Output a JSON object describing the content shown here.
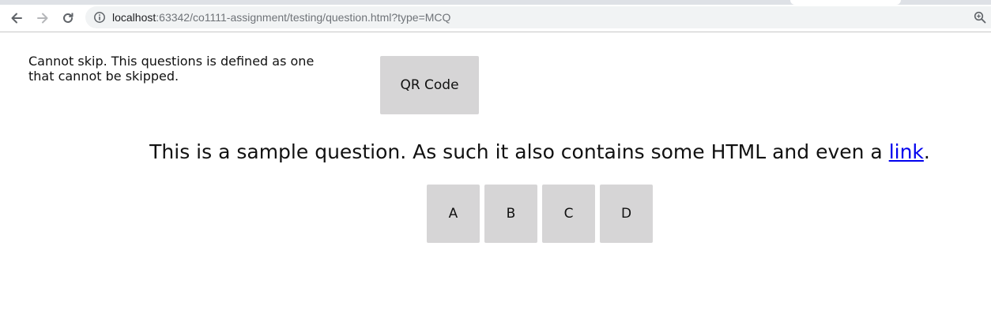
{
  "browser": {
    "url_host": "localhost",
    "url_path": ":63342/co1111-assignment/testing/question.html?type=MCQ",
    "icons": [
      "back-arrow-icon",
      "forward-arrow-icon",
      "reload-icon",
      "info-icon",
      "zoom-icon"
    ]
  },
  "page": {
    "skip_note": "Cannot skip. This questions is defined as one that cannot be skipped.",
    "qr_button_label": "QR Code",
    "question_before_link": "This is a sample question. As such it also contains some HTML and even a ",
    "question_link_text": "link",
    "question_after_link": ".",
    "answers": [
      "A",
      "B",
      "C",
      "D"
    ]
  },
  "colors": {
    "button_bg": "#d6d5d6",
    "link": "#0000ee",
    "omnibox_bg": "#f1f3f4"
  }
}
